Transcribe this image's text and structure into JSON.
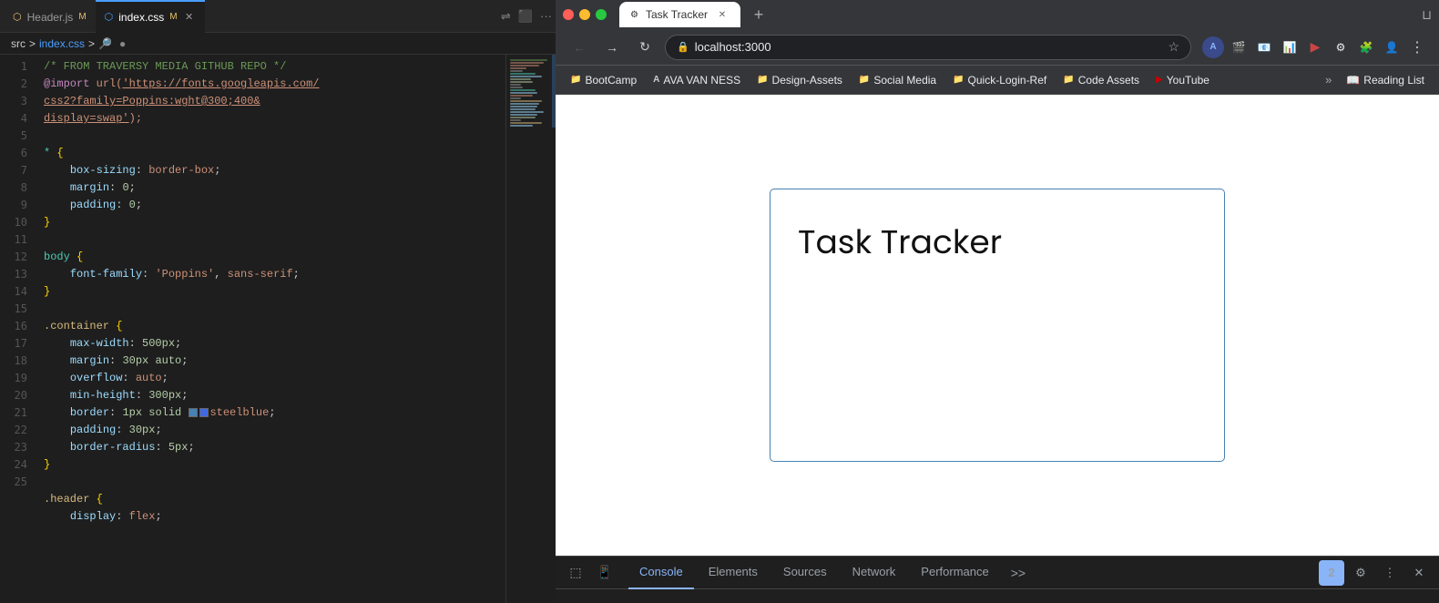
{
  "editor": {
    "tabs": [
      {
        "label": "Header.js",
        "badge": "M",
        "type": "js",
        "active": false
      },
      {
        "label": "index.css",
        "badge": "M",
        "type": "css",
        "active": true
      }
    ],
    "breadcrumb": [
      "src",
      ">",
      "index.css",
      ">",
      "🔎"
    ],
    "code_lines": [
      {
        "num": 1,
        "content": "comment",
        "text": "/* FROM TRAVERSY MEDIA GITHUB REPO */"
      },
      {
        "num": 2,
        "content": "import",
        "text": "@import url('https://fonts.googleapis.com/css2?family=Poppins:wght@300;400&display=swap');"
      },
      {
        "num": 3,
        "content": "blank"
      },
      {
        "num": 4,
        "content": "selector",
        "text": "* {"
      },
      {
        "num": 5,
        "content": "prop-val",
        "prop": "box-sizing",
        "val": "border-box;"
      },
      {
        "num": 6,
        "content": "prop-val-num",
        "prop": "margin",
        "val": "0;"
      },
      {
        "num": 7,
        "content": "prop-val-num",
        "prop": "padding",
        "val": "0;"
      },
      {
        "num": 8,
        "content": "close-brace"
      },
      {
        "num": 9,
        "content": "blank"
      },
      {
        "num": 10,
        "content": "selector",
        "text": "body {"
      },
      {
        "num": 11,
        "content": "prop-val",
        "prop": "font-family",
        "val": "'Poppins', sans-serif;"
      },
      {
        "num": 12,
        "content": "close-brace"
      },
      {
        "num": 13,
        "content": "blank"
      },
      {
        "num": 14,
        "content": "selector2",
        "text": ".container {"
      },
      {
        "num": 15,
        "content": "prop-val-num",
        "prop": "max-width",
        "val": "500px;"
      },
      {
        "num": 16,
        "content": "prop-val-num",
        "prop": "margin",
        "val": "30px auto;"
      },
      {
        "num": 17,
        "content": "prop-val",
        "prop": "overflow",
        "val": "auto;"
      },
      {
        "num": 18,
        "content": "prop-val-num",
        "prop": "min-height",
        "val": "300px;"
      },
      {
        "num": 19,
        "content": "prop-val-color",
        "prop": "border",
        "val": "1px solid",
        "color": "steelblue",
        "color_hex": "#4682b4"
      },
      {
        "num": 20,
        "content": "prop-val-num",
        "prop": "padding",
        "val": "30px;"
      },
      {
        "num": 21,
        "content": "prop-val-num",
        "prop": "border-radius",
        "val": "5px;"
      },
      {
        "num": 22,
        "content": "close-brace"
      },
      {
        "num": 23,
        "content": "blank"
      },
      {
        "num": 24,
        "content": "selector2",
        "text": ".header {"
      },
      {
        "num": 25,
        "content": "prop-val",
        "prop": "display",
        "val": "flex;"
      }
    ]
  },
  "browser": {
    "url": "localhost:3000",
    "tab_title": "Task Tracker",
    "bookmarks": [
      {
        "label": "BootCamp",
        "icon": "📁"
      },
      {
        "label": "AVA VAN NESS",
        "icon": "A"
      },
      {
        "label": "Design-Assets",
        "icon": "📁"
      },
      {
        "label": "Social Media",
        "icon": "📁"
      },
      {
        "label": "Quick-Login-Ref",
        "icon": "📁"
      },
      {
        "label": "Code Assets",
        "icon": "📁"
      },
      {
        "label": "YouTube",
        "icon": "▶"
      }
    ],
    "reading_list_label": "Reading List",
    "page_title": "Task Tracker"
  },
  "devtools": {
    "tabs": [
      {
        "label": "Console",
        "active": true
      },
      {
        "label": "Elements",
        "active": false
      },
      {
        "label": "Sources",
        "active": false
      },
      {
        "label": "Network",
        "active": false
      },
      {
        "label": "Performance",
        "active": false
      }
    ],
    "badge_count": "2",
    "more_label": ">>"
  }
}
